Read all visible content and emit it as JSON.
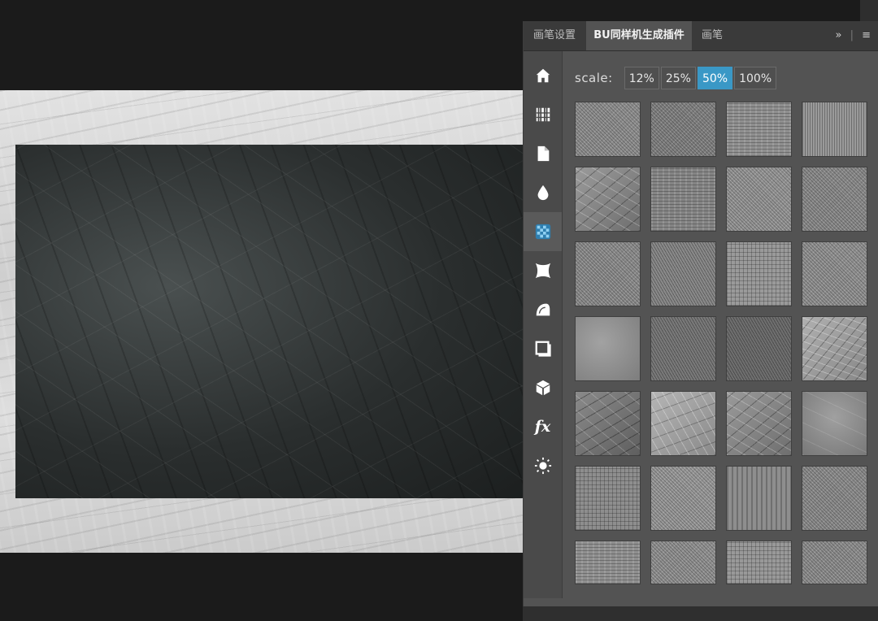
{
  "panel": {
    "tabs": [
      {
        "label": "画笔设置",
        "active": false
      },
      {
        "label": "BU同样机生成插件",
        "active": true
      },
      {
        "label": "画笔",
        "active": false
      }
    ],
    "tabbar_menu": {
      "expand": "»",
      "divider": "|",
      "menu": "≡"
    }
  },
  "sidebar": {
    "items": [
      {
        "icon": "home-icon"
      },
      {
        "icon": "barcode-grid-icon"
      },
      {
        "icon": "document-icon"
      },
      {
        "icon": "drop-icon"
      },
      {
        "icon": "texture-icon",
        "active": true
      },
      {
        "icon": "warp-icon"
      },
      {
        "icon": "fabric-icon"
      },
      {
        "icon": "shadow-square-icon"
      },
      {
        "icon": "cube-icon"
      },
      {
        "icon": "fx-icon",
        "label": "fx"
      },
      {
        "icon": "light-icon"
      }
    ]
  },
  "scale": {
    "label": "scale:",
    "options": [
      "12%",
      "25%",
      "50%",
      "100%"
    ],
    "selected": "50%"
  },
  "textures": {
    "count": 28,
    "columns": 4,
    "rows": 7
  },
  "colors": {
    "accent": "#3a98c6",
    "panel_bg": "#535353",
    "tab_bg": "#3a3a3a",
    "canvas_bg": "#1b1b1b"
  }
}
